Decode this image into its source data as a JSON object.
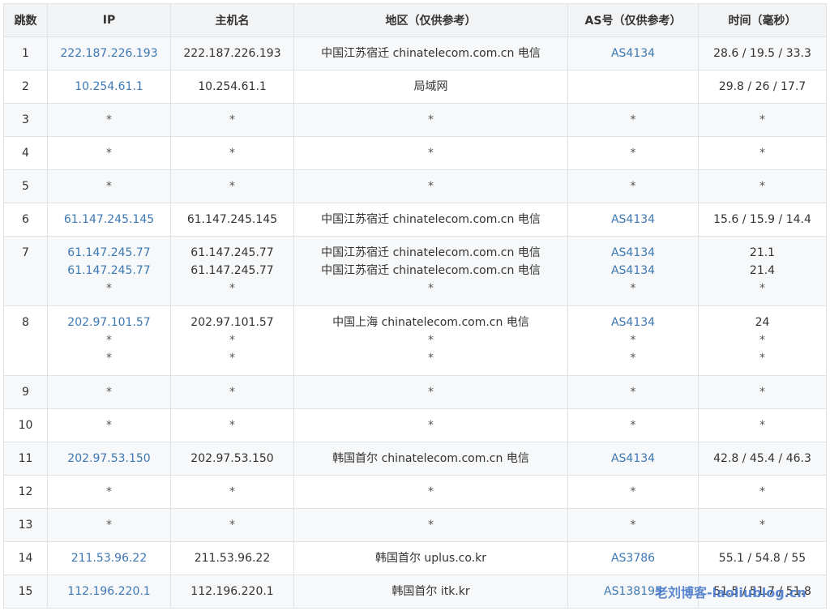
{
  "headers": [
    "跳数",
    "IP",
    "主机名",
    "地区（仅供参考）",
    "AS号（仅供参考）",
    "时间（毫秒）"
  ],
  "rows": [
    {
      "hop": "1",
      "lines": [
        {
          "ip": "222.187.226.193",
          "host": "222.187.226.193",
          "region": "中国江苏宿迁 chinatelecom.com.cn 电信",
          "as": "AS4134",
          "time": "28.6 / 19.5 / 33.3"
        }
      ]
    },
    {
      "hop": "2",
      "lines": [
        {
          "ip": "10.254.61.1",
          "host": "10.254.61.1",
          "region": "局域网",
          "as": "",
          "time": "29.8 / 26 / 17.7"
        }
      ]
    },
    {
      "hop": "3",
      "lines": [
        {
          "ip": "*",
          "host": "*",
          "region": "*",
          "as": "*",
          "time": "*"
        }
      ]
    },
    {
      "hop": "4",
      "lines": [
        {
          "ip": "*",
          "host": "*",
          "region": "*",
          "as": "*",
          "time": "*"
        }
      ]
    },
    {
      "hop": "5",
      "lines": [
        {
          "ip": "*",
          "host": "*",
          "region": "*",
          "as": "*",
          "time": "*"
        }
      ]
    },
    {
      "hop": "6",
      "lines": [
        {
          "ip": "61.147.245.145",
          "host": "61.147.245.145",
          "region": "中国江苏宿迁 chinatelecom.com.cn 电信",
          "as": "AS4134",
          "time": "15.6 / 15.9 / 14.4"
        }
      ]
    },
    {
      "hop": "7",
      "lines": [
        {
          "ip": "61.147.245.77",
          "host": "61.147.245.77",
          "region": "中国江苏宿迁 chinatelecom.com.cn 电信",
          "as": "AS4134",
          "time": "21.1"
        },
        {
          "ip": "61.147.245.77",
          "host": "61.147.245.77",
          "region": "中国江苏宿迁 chinatelecom.com.cn 电信",
          "as": "AS4134",
          "time": "21.4"
        },
        {
          "ip": "*",
          "host": "*",
          "region": "*",
          "as": "*",
          "time": "*"
        }
      ]
    },
    {
      "hop": "8",
      "lines": [
        {
          "ip": "202.97.101.57",
          "host": "202.97.101.57",
          "region": "中国上海 chinatelecom.com.cn 电信",
          "as": "AS4134",
          "time": "24"
        },
        {
          "ip": "*",
          "host": "*",
          "region": "*",
          "as": "*",
          "time": "*"
        },
        {
          "ip": "*",
          "host": "*",
          "region": "*",
          "as": "*",
          "time": "*"
        }
      ]
    },
    {
      "hop": "9",
      "lines": [
        {
          "ip": "*",
          "host": "*",
          "region": "*",
          "as": "*",
          "time": "*"
        }
      ]
    },
    {
      "hop": "10",
      "lines": [
        {
          "ip": "*",
          "host": "*",
          "region": "*",
          "as": "*",
          "time": "*"
        }
      ]
    },
    {
      "hop": "11",
      "lines": [
        {
          "ip": "202.97.53.150",
          "host": "202.97.53.150",
          "region": "韩国首尔 chinatelecom.com.cn 电信",
          "as": "AS4134",
          "time": "42.8 / 45.4 / 46.3"
        }
      ]
    },
    {
      "hop": "12",
      "lines": [
        {
          "ip": "*",
          "host": "*",
          "region": "*",
          "as": "*",
          "time": "*"
        }
      ]
    },
    {
      "hop": "13",
      "lines": [
        {
          "ip": "*",
          "host": "*",
          "region": "*",
          "as": "*",
          "time": "*"
        }
      ]
    },
    {
      "hop": "14",
      "lines": [
        {
          "ip": "211.53.96.22",
          "host": "211.53.96.22",
          "region": "韩国首尔 uplus.co.kr",
          "as": "AS3786",
          "time": "55.1 / 54.8 / 55"
        }
      ]
    },
    {
      "hop": "15",
      "lines": [
        {
          "ip": "112.196.220.1",
          "host": "112.196.220.1",
          "region": "韩国首尔 itk.kr",
          "as": "AS138195",
          "time": "51.5 / 51.7 / 51.8"
        }
      ]
    }
  ],
  "watermark": "老刘博客-laoliublog.cn",
  "colors": {
    "link": "#3c78b4",
    "header_bg": "#f2f3f4",
    "stripe_bg": "#f7f8f9",
    "border": "#dfe3e6",
    "watermark": "#3f72c9"
  }
}
